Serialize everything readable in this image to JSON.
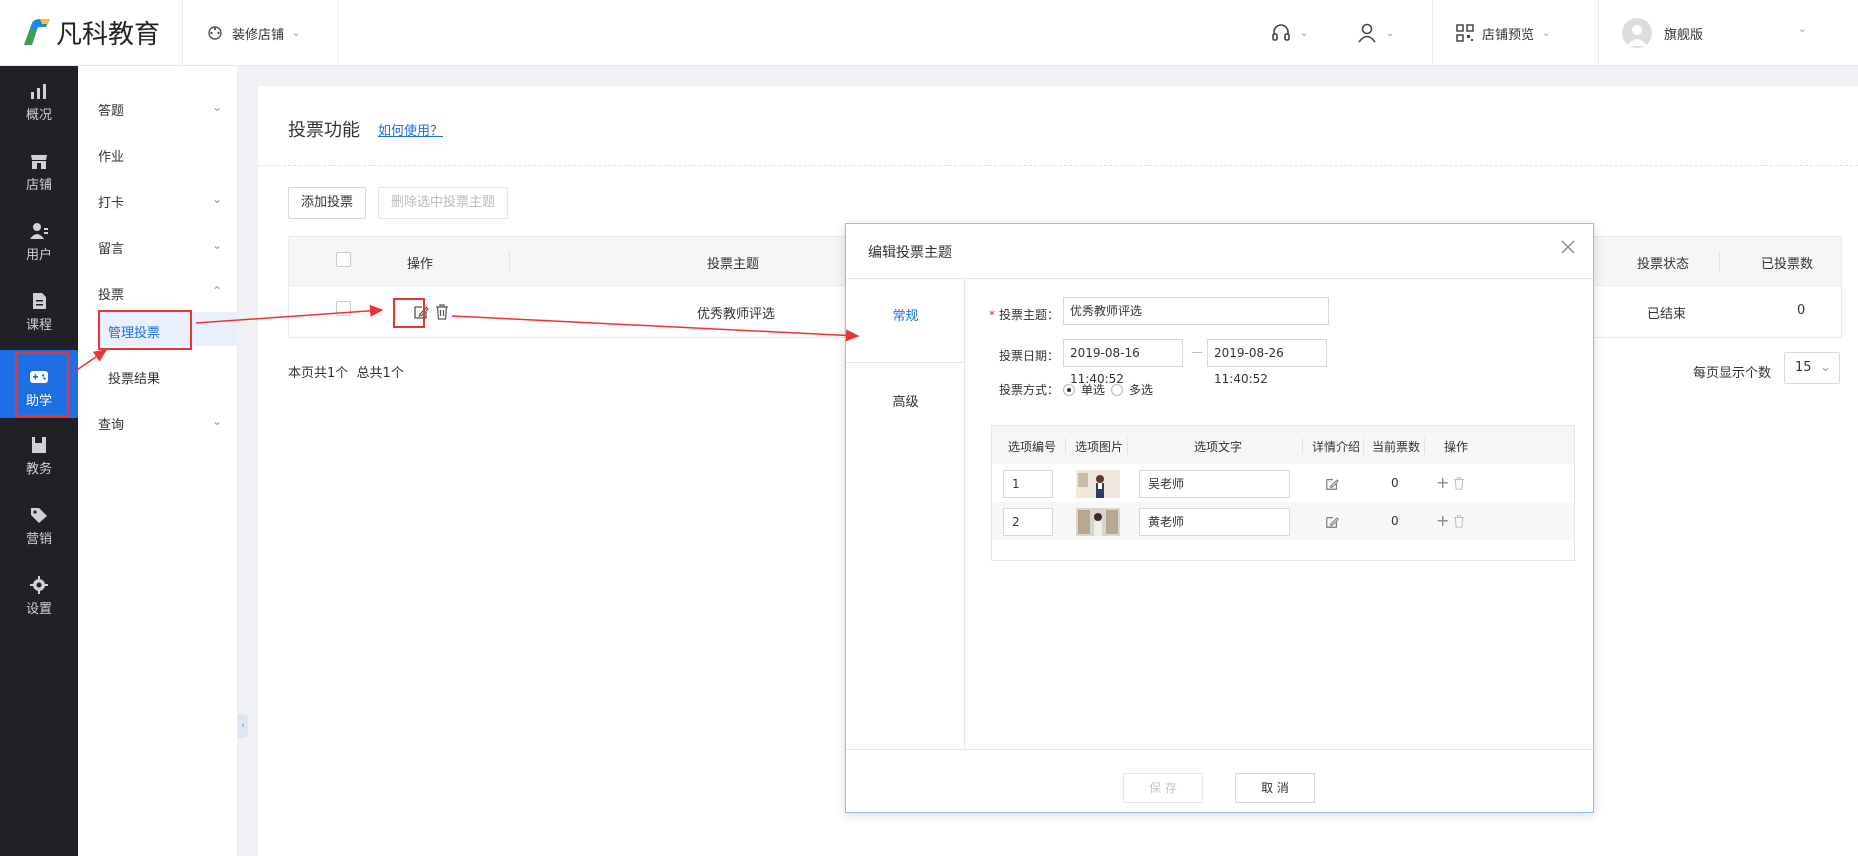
{
  "brand": {
    "name": "凡科教育"
  },
  "topbar": {
    "decorate_label": "装修店铺",
    "preview_label": "店铺预览",
    "user_label": "旗舰版"
  },
  "leftnav": {
    "items": [
      {
        "label": "概况",
        "icon": "chart-icon"
      },
      {
        "label": "店铺",
        "icon": "store-icon"
      },
      {
        "label": "用户",
        "icon": "users-icon"
      },
      {
        "label": "课程",
        "icon": "document-icon"
      },
      {
        "label": "助学",
        "icon": "gamepad-icon"
      },
      {
        "label": "教务",
        "icon": "book-icon"
      },
      {
        "label": "营销",
        "icon": "tag-icon"
      },
      {
        "label": "设置",
        "icon": "gear-icon"
      }
    ],
    "active": "助学"
  },
  "subnav": {
    "items": [
      {
        "label": "答题",
        "expandable": true
      },
      {
        "label": "作业",
        "expandable": false
      },
      {
        "label": "打卡",
        "expandable": true
      },
      {
        "label": "留言",
        "expandable": true
      },
      {
        "label": "投票",
        "expandable": true
      },
      {
        "label": "投票结果",
        "expandable": false
      },
      {
        "label": "查询",
        "expandable": true
      }
    ],
    "active_label": "管理投票"
  },
  "main": {
    "title": "投票功能",
    "howto_link": "如何使用？",
    "add_button": "添加投票",
    "delete_button": "删除选中投票主题",
    "table": {
      "headers": [
        "操作",
        "投票主题",
        "投票状态",
        "已投票数"
      ],
      "rows": [
        {
          "topic": "优秀教师评选",
          "status": "已结束",
          "votes": "0"
        }
      ]
    },
    "pager_total_pages": "本页共1个",
    "pager_total": "总共1个",
    "per_page_label": "每页显示个数",
    "per_page_value": "15"
  },
  "modal": {
    "title": "编辑投票主题",
    "tabs": [
      "常规",
      "高级"
    ],
    "active_tab": "常规",
    "topic_label": "投票主题：",
    "topic_value": "优秀教师评选",
    "date_label": "投票日期：",
    "date_start": "2019-08-16 11:40:52",
    "date_sep": "—",
    "date_end": "2019-08-26 11:40:52",
    "mode_label": "投票方式：",
    "mode_single": "单选",
    "mode_multi": "多选",
    "mode_selected": "单选",
    "options_headers": [
      "选项编号",
      "选项图片",
      "选项文字",
      "详情介绍",
      "当前票数",
      "操作"
    ],
    "options": [
      {
        "no": "1",
        "text": "吴老师",
        "votes": "0"
      },
      {
        "no": "2",
        "text": "黄老师",
        "votes": "0"
      }
    ],
    "save_button": "保 存",
    "cancel_button": "取 消"
  },
  "colors": {
    "accent": "#1e6fe3",
    "annotation_red": "#e33333",
    "nav_dark": "#1f2127"
  }
}
